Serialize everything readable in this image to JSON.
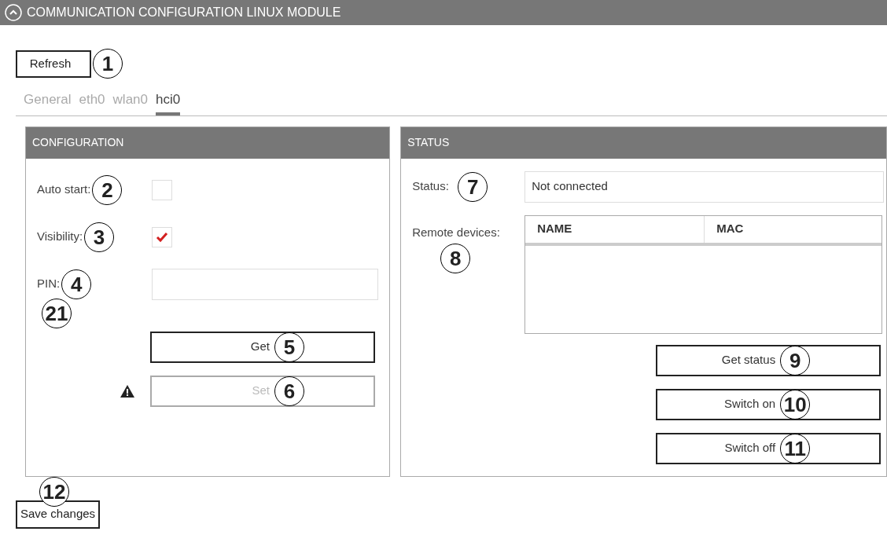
{
  "header": {
    "title": "COMMUNICATION CONFIGURATION LINUX MODULE"
  },
  "refresh_button": {
    "label": "Refresh",
    "callout": "1"
  },
  "tabs": [
    {
      "label": "General",
      "selected": false
    },
    {
      "label": "eth0",
      "selected": false
    },
    {
      "label": "wlan0",
      "selected": false
    },
    {
      "label": "hci0",
      "selected": true
    }
  ],
  "configuration": {
    "title": "CONFIGURATION",
    "fields": [
      {
        "kind": "checkbox",
        "label": "Auto start:",
        "callout": "2",
        "checked": false
      },
      {
        "kind": "checkbox",
        "label": "Visibility:",
        "callout": "3",
        "checked": true
      },
      {
        "kind": "text",
        "label": "PIN:",
        "callout": "4"
      }
    ],
    "area_callout": "21",
    "buttons": [
      {
        "label": "Get",
        "callout": "5",
        "disabled": false,
        "warning": false
      },
      {
        "label": "Set",
        "callout": "6",
        "disabled": true,
        "warning": true
      }
    ]
  },
  "status": {
    "title": "STATUS",
    "status_label": "Status:",
    "status_callout": "7",
    "status_value": "Not connected",
    "devices_label": "Remote devices:",
    "devices_callout": "8",
    "columns": [
      "NAME",
      "MAC"
    ],
    "buttons": [
      {
        "label": "Get status",
        "callout": "9",
        "disabled": false
      },
      {
        "label": "Switch on",
        "callout": "10",
        "disabled": false
      },
      {
        "label": "Switch off",
        "callout": "11",
        "disabled": false
      }
    ]
  },
  "save_button": {
    "label": "Save changes",
    "callout": "12"
  }
}
